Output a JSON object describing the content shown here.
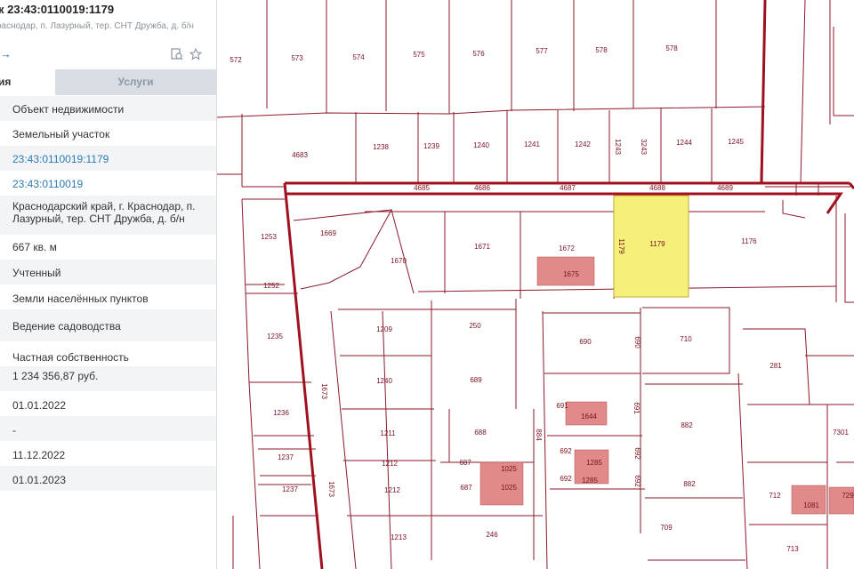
{
  "header": {
    "title": "к 23:43:0110019:1179",
    "subtitle": "раснодар, п. Лазурный, тер. СНТ Дружба, д. б/н",
    "arrow": "→"
  },
  "tabs": [
    {
      "label": "ия"
    },
    {
      "label": "Услуги"
    }
  ],
  "info_rows": [
    "Объект недвижимости",
    "Земельный участок",
    "23:43:0110019:1179",
    "23:43:0110019",
    "Краснодарский край, г. Краснодар, п. Лазурный, тер. СНТ Дружба, д. б/н",
    "667 кв. м",
    "Учтенный",
    "Земли населённых пунктов",
    "Ведение садоводства",
    "Частная собственность",
    "1 234 356,87 руб.",
    "01.01.2022",
    "-",
    "11.12.2022",
    "01.01.2023"
  ],
  "map_labels": [
    "572",
    "573",
    "574",
    "575",
    "576",
    "577",
    "578",
    "578",
    "4683",
    "1238",
    "1239",
    "1240",
    "1241",
    "1242",
    "1243",
    "3243",
    "1244",
    "1245",
    "4685",
    "4686",
    "4687",
    "4688",
    "4689",
    "1253",
    "1669",
    "1670",
    "1671",
    "1672",
    "1675",
    "1179",
    "1179",
    "1176",
    "1252",
    "1235",
    "1209",
    "250",
    "690",
    "690",
    "710",
    "281",
    "1240",
    "689",
    "691",
    "1644",
    "691",
    "882",
    "1236",
    "1211",
    "688",
    "884",
    "692",
    "1285",
    "692",
    "692",
    "1285",
    "692",
    "7301",
    "1237",
    "1212",
    "687",
    "1025",
    "1212",
    "687",
    "1025",
    "882",
    "712",
    "1081",
    "729",
    "1237",
    "1673",
    "1673",
    "1213",
    "246",
    "709",
    "713"
  ],
  "colors": {
    "boundary": "#a0101e",
    "selected_fill": "#f5f07a",
    "building_fill": "#e08a8a",
    "link": "#2b7bb4"
  }
}
